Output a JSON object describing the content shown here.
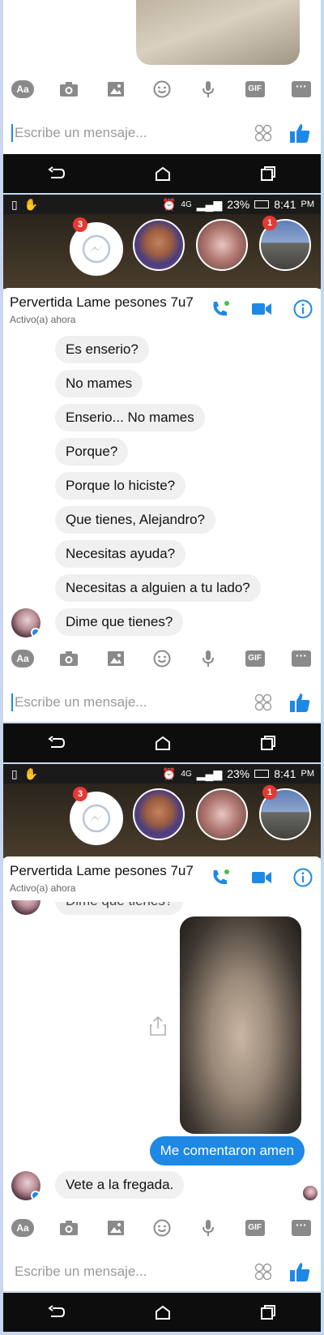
{
  "contact": {
    "name": "Pervertida Lame pesones 7u7",
    "status": "Activo(a) ahora"
  },
  "statusbar": {
    "network": "4G",
    "battery": "23%",
    "time": "8:41",
    "ampm": "PM"
  },
  "chat_heads": [
    {
      "name": "messenger-head",
      "badge": "3"
    },
    {
      "name": "contact-head-boy"
    },
    {
      "name": "contact-head-girl"
    },
    {
      "name": "contact-head-outdoor",
      "badge": "1"
    }
  ],
  "toolbar": {
    "text_label": "Aa",
    "gif_label": "GIF",
    "more_label": "···"
  },
  "composer": {
    "placeholder": "Escribe un mensaje..."
  },
  "messages_screen2": [
    "Es enserio?",
    "No mames",
    "Enserio... No mames",
    "Porque?",
    "Porque lo hiciste?",
    "Que tienes, Alejandro?",
    "Necesitas ayuda?",
    "Necesitas a alguien a tu lado?",
    "Dime que tienes?"
  ],
  "screen3": {
    "partial_message": "Dime que tienes?",
    "sent_message": "Me comentaron amen",
    "reply_message": "Vete a la fregada."
  },
  "colors": {
    "accent": "#1e88e5",
    "incoming_bubble": "#f0f0f0",
    "outer_border": "#c8d6ee"
  }
}
